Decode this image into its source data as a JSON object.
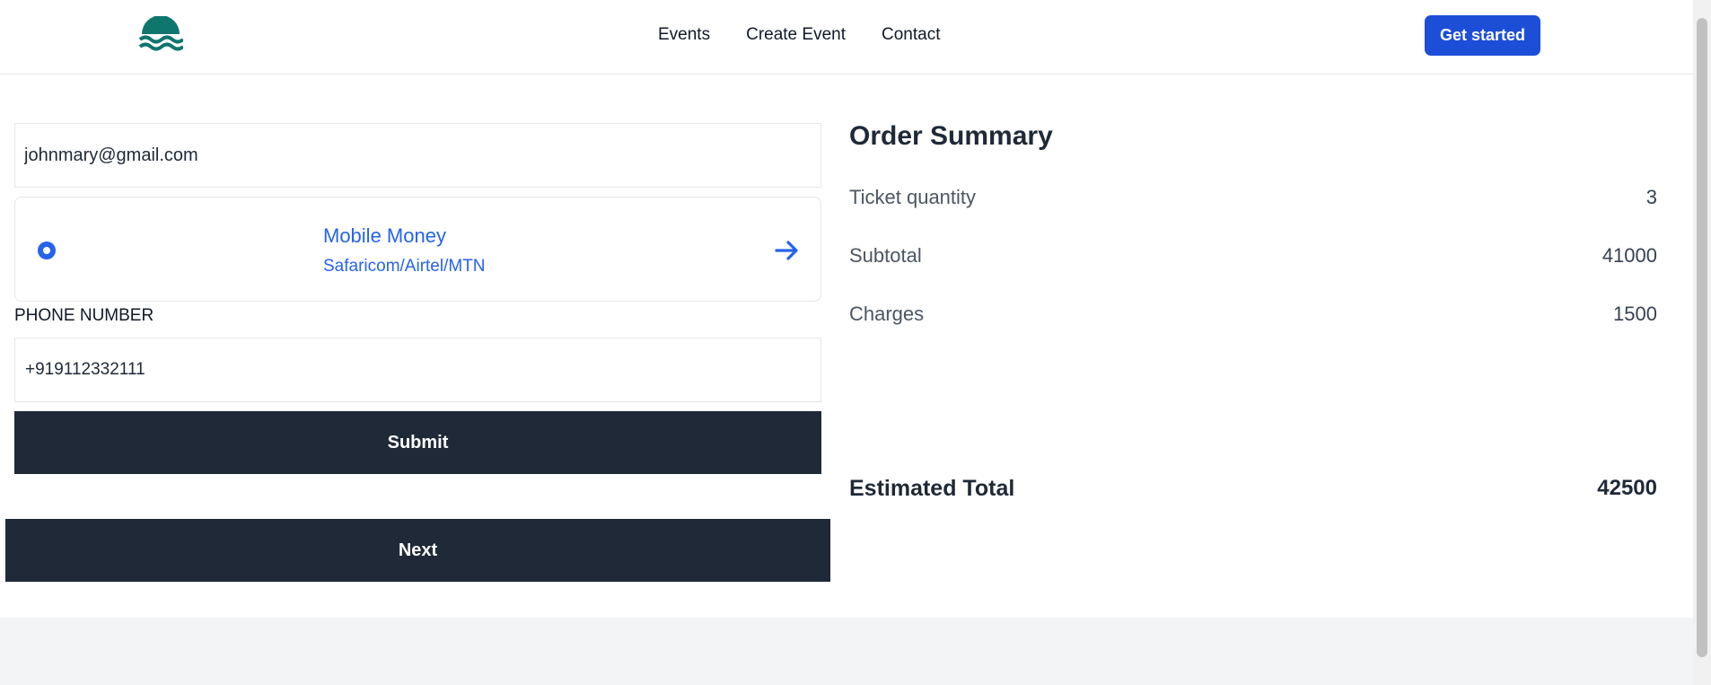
{
  "header": {
    "logo": "wave-logo-icon",
    "nav": [
      "Events",
      "Create Event",
      "Contact"
    ],
    "cta_label": "Get started"
  },
  "form": {
    "email_value": "johnmary@gmail.com",
    "payment_method": {
      "name": "Mobile Money",
      "providers": "Safaricom/Airtel/MTN",
      "selected": true,
      "icon": "arrow-right-icon"
    },
    "phone_label": "PHONE NUMBER",
    "phone_value": "+919112332111",
    "submit_label": "Submit",
    "next_label": "Next"
  },
  "summary": {
    "title": "Order Summary",
    "rows": [
      {
        "label": "Ticket quantity",
        "value": "3"
      },
      {
        "label": "Subtotal",
        "value": "41000"
      },
      {
        "label": "Charges",
        "value": "1500"
      }
    ],
    "total_label": "Estimated Total",
    "total_value": "42500"
  },
  "colors": {
    "accent": "#1d4ed8",
    "link_blue": "#2563eb",
    "dark_button": "#1f2937",
    "logo": "#0f766e"
  }
}
